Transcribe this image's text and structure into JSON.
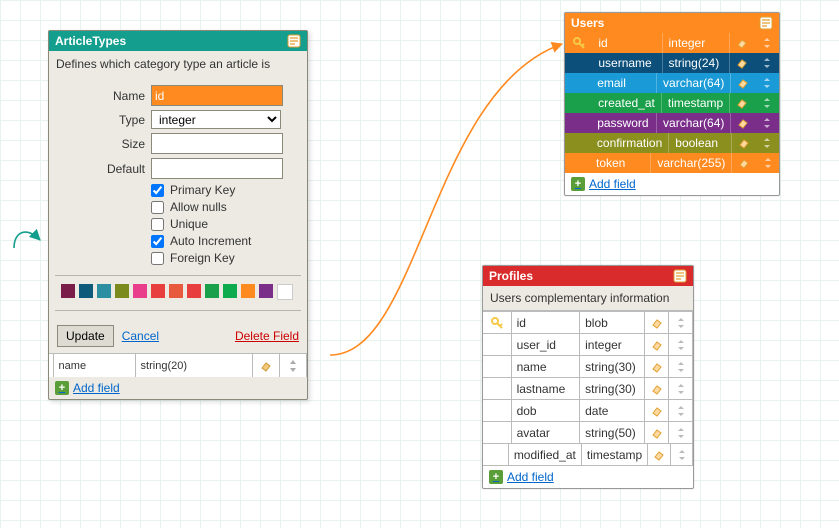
{
  "article_types": {
    "title": "ArticleTypes",
    "description": "Defines which category type an article is",
    "form": {
      "name_label": "Name",
      "name_value": "id",
      "type_label": "Type",
      "type_value": "integer",
      "size_label": "Size",
      "size_value": "",
      "default_label": "Default",
      "default_value": "",
      "primary_key": {
        "label": "Primary Key",
        "checked": true
      },
      "allow_nulls": {
        "label": "Allow nulls",
        "checked": false
      },
      "unique": {
        "label": "Unique",
        "checked": false
      },
      "auto_increment": {
        "label": "Auto Increment",
        "checked": true
      },
      "foreign_key": {
        "label": "Foreign Key",
        "checked": false
      }
    },
    "colors": [
      "#7a1d49",
      "#0e5a7a",
      "#2b8ea1",
      "#7a8a1d",
      "#e83e8c",
      "#e83e3e",
      "#e85a3e",
      "#e83e3e",
      "#1aa04a",
      "#0eab4e",
      "#ff8a1f",
      "#7a2e8a",
      "#ffffff"
    ],
    "update_label": "Update",
    "cancel_label": "Cancel",
    "delete_label": "Delete Field",
    "existing_row": {
      "name": "name",
      "type": "string(20)"
    },
    "add_field_label": "Add field"
  },
  "users": {
    "title": "Users",
    "add_field_label": "Add field",
    "rows": [
      {
        "bg": "#ff8a1f",
        "key": true,
        "name": "id",
        "type": "integer"
      },
      {
        "bg": "#0b4f7a",
        "key": false,
        "name": "username",
        "type": "string(24)"
      },
      {
        "bg": "#1a9ad6",
        "key": false,
        "name": "email",
        "type": "varchar(64)"
      },
      {
        "bg": "#1aa04a",
        "key": false,
        "name": "created_at",
        "type": "timestamp"
      },
      {
        "bg": "#7a2e8a",
        "key": false,
        "name": "password",
        "type": "varchar(64)"
      },
      {
        "bg": "#8a8f1d",
        "key": false,
        "name": "confirmation",
        "type": "boolean"
      },
      {
        "bg": "#ff8a1f",
        "key": false,
        "name": "token",
        "type": "varchar(255)"
      }
    ]
  },
  "profiles": {
    "title": "Profiles",
    "subtitle": "Users complementary information",
    "add_field_label": "Add field",
    "rows": [
      {
        "key": true,
        "name": "id",
        "type": "blob"
      },
      {
        "key": false,
        "name": "user_id",
        "type": "integer"
      },
      {
        "key": false,
        "name": "name",
        "type": "string(30)"
      },
      {
        "key": false,
        "name": "lastname",
        "type": "string(30)"
      },
      {
        "key": false,
        "name": "dob",
        "type": "date"
      },
      {
        "key": false,
        "name": "avatar",
        "type": "string(50)"
      },
      {
        "key": false,
        "name": "modified_at",
        "type": "timestamp"
      }
    ]
  }
}
